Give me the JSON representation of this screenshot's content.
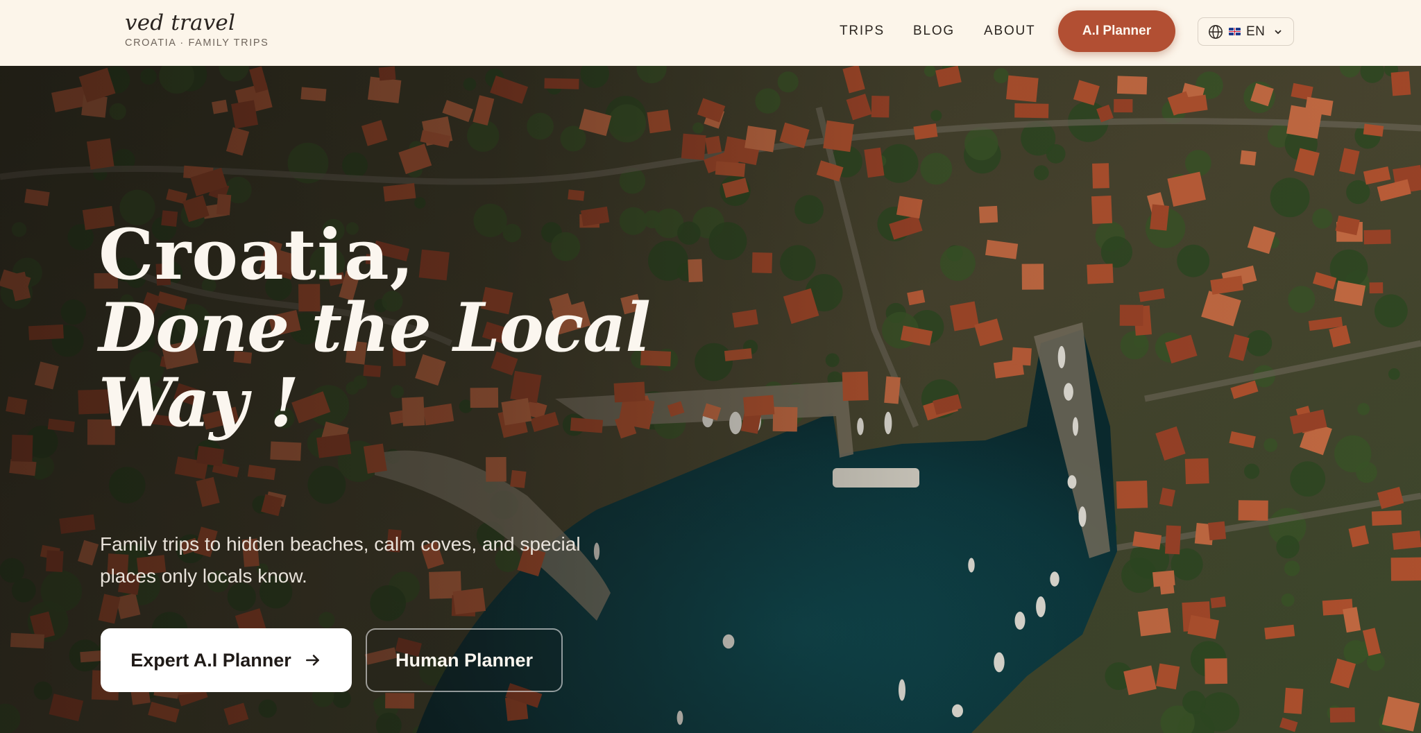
{
  "brand": {
    "name": "ved travel",
    "tagline": "CROATIA · FAMILY TRIPS"
  },
  "nav": {
    "trips": "TRIPS",
    "blog": "BLOG",
    "about": "ABOUT",
    "ai_planner": "A.I Planner",
    "language": "EN",
    "icons": [
      "globe-icon",
      "uk-flag-icon",
      "chevron-down-icon"
    ]
  },
  "hero": {
    "title_line1": "Croatia,",
    "title_line2": "Done the Local",
    "title_line3": "Way !",
    "subtitle": "Family trips to hidden beaches, calm coves, and special places only locals know.",
    "primary_button": "Expert A.I Planner",
    "secondary_button": "Human Planner"
  },
  "colors": {
    "header_bg": "#fcf5ea",
    "accent": "#b24f33",
    "hero_text": "#fbf6ef"
  }
}
